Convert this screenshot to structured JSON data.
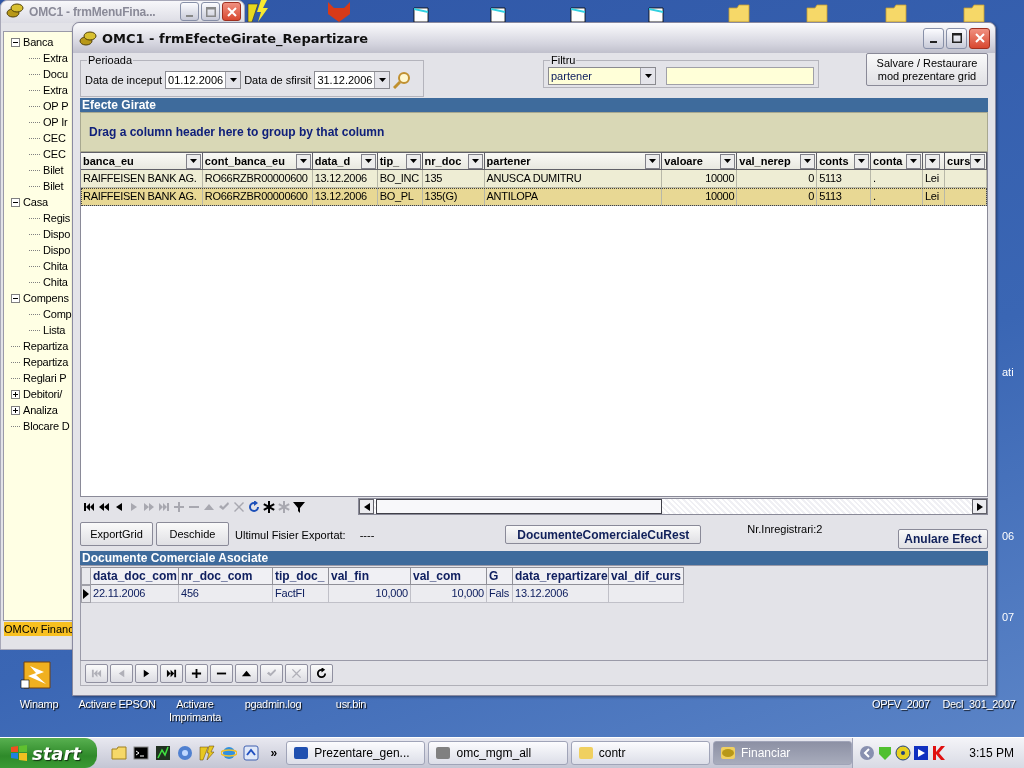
{
  "desktop": {
    "bottom_icons": [
      {
        "label": "Winamp"
      },
      {
        "label": "Activare EPSON"
      },
      {
        "label": "Activare Imprimanta"
      },
      {
        "label": "pgadmin.log"
      },
      {
        "label": "usr.bin"
      },
      {
        "label": "OPFV_2007"
      },
      {
        "label": "Decl_301_2007"
      }
    ],
    "edge_labels": [
      "ati",
      "06",
      "07"
    ]
  },
  "back_window": {
    "title": "OMC1 - frmMenuFina...",
    "tree": [
      {
        "label": "Banca",
        "expanded": true,
        "children": [
          {
            "label": "Extra"
          },
          {
            "label": "Docu"
          },
          {
            "label": "Extra"
          },
          {
            "label": "OP P"
          },
          {
            "label": "OP Ir"
          },
          {
            "label": "CEC"
          },
          {
            "label": "CEC"
          },
          {
            "label": "Bilet"
          },
          {
            "label": "Bilet"
          }
        ]
      },
      {
        "label": "Casa",
        "expanded": true,
        "children": [
          {
            "label": "Regis"
          },
          {
            "label": "Dispo"
          },
          {
            "label": "Dispo"
          },
          {
            "label": "Chita"
          },
          {
            "label": "Chita"
          }
        ]
      },
      {
        "label": "Compens",
        "expanded": true,
        "children": [
          {
            "label": "Comp"
          },
          {
            "label": "Lista"
          }
        ]
      },
      {
        "label": "Repartiza"
      },
      {
        "label": "Repartiza"
      },
      {
        "label": "Reglari P"
      },
      {
        "label": "Debitori/",
        "expanded": false
      },
      {
        "label": "Analiza",
        "expanded": false
      },
      {
        "label": "Blocare D"
      }
    ],
    "status": "OMCw Financ"
  },
  "window": {
    "title": "OMC1 - frmEfecteGirate_Repartizare",
    "period": {
      "legend": "Perioada",
      "start_label": "Data de inceput",
      "start_value": "01.12.2006",
      "end_label": "Data de sfirsit",
      "end_value": "31.12.2006"
    },
    "filter": {
      "legend": "Filtru",
      "field": "partener"
    },
    "save_button": "Salvare / Restaurare\nmod prezentare grid",
    "section_1": "Efecte Girate",
    "group_panel": "Drag a column header here to group by that column",
    "table": {
      "columns": [
        {
          "label": "banca_eu"
        },
        {
          "label": "cont_banca_eu"
        },
        {
          "label": "data_d"
        },
        {
          "label": "tip_"
        },
        {
          "label": "nr_doc"
        },
        {
          "label": "partener"
        },
        {
          "label": "valoare"
        },
        {
          "label": "val_nerep"
        },
        {
          "label": "conts"
        },
        {
          "label": "conta"
        },
        {},
        {
          "label": "curs"
        }
      ],
      "rows": [
        {
          "selected": false,
          "cells": [
            "RAIFFEISEN BANK AG.",
            "RO66RZBR00000600",
            "13.12.2006",
            "BO_INC",
            "135",
            "ANUSCA DUMITRU",
            "10000",
            "0",
            "5113",
            ".",
            "Lei",
            null
          ]
        },
        {
          "selected": true,
          "cells": [
            "RAIFFEISEN BANK AG.",
            "RO66RZBR00000600",
            "13.12.2006",
            "BO_PL",
            "135(G)",
            "ANTILOPA",
            "10000",
            "0",
            "5113",
            ".",
            "Lei",
            null
          ]
        }
      ]
    },
    "navigator": [
      {
        "kind": "first",
        "disabled": false
      },
      {
        "kind": "prev_page",
        "disabled": false
      },
      {
        "kind": "prev",
        "disabled": false
      },
      {
        "kind": "next",
        "disabled": true
      },
      {
        "kind": "next_page",
        "disabled": true
      },
      {
        "kind": "last",
        "disabled": true
      },
      {
        "kind": "add",
        "disabled": true
      },
      {
        "kind": "remove",
        "disabled": true
      },
      {
        "kind": "up",
        "disabled": true
      },
      {
        "kind": "check",
        "disabled": true
      },
      {
        "kind": "cancel",
        "disabled": true
      },
      {
        "kind": "refresh",
        "disabled": false
      },
      {
        "kind": "star",
        "disabled": false
      },
      {
        "kind": "star",
        "disabled": true
      },
      {
        "kind": "filter",
        "disabled": false
      }
    ],
    "export_button": "ExportGrid",
    "open_button": "Deschide",
    "last_export_label": "Ultimul Fisier Exportat:",
    "last_export_value": "----",
    "docs_button": "DocumenteComercialeCuRest",
    "record_count": "Nr.Inregistrari:2",
    "cancel_button": "Anulare Efect",
    "section_2": "Documente Comerciale Asociate",
    "table_2": {
      "columns": [
        "data_doc_com",
        "nr_doc_com",
        "tip_doc_",
        "val_fin",
        "val_com",
        "G",
        "data_repartizare",
        "val_dif_curs"
      ],
      "rows": [
        {
          "current": true,
          "cells": [
            "22.11.2006",
            "456",
            "FactFI",
            "10,000",
            "10,000",
            "Fals",
            "13.12.2006",
            null
          ]
        }
      ]
    },
    "bottom_navigator": [
      {
        "kind": "first",
        "disabled": true
      },
      {
        "kind": "prev",
        "disabled": true
      },
      {
        "kind": "next",
        "disabled": false
      },
      {
        "kind": "last",
        "disabled": false
      },
      {
        "kind": "add",
        "disabled": false
      },
      {
        "kind": "remove",
        "disabled": false
      },
      {
        "kind": "up",
        "disabled": false
      },
      {
        "kind": "check",
        "disabled": true
      },
      {
        "kind": "cancel",
        "disabled": true
      },
      {
        "kind": "refresh",
        "disabled": false
      }
    ]
  },
  "taskbar": {
    "start": "start",
    "overflow": "»",
    "tasks": [
      {
        "label": "Prezentare_gen...",
        "selected": false
      },
      {
        "label": "omc_mgm_all",
        "selected": false
      },
      {
        "label": "contr",
        "selected": false
      },
      {
        "label": "Financiar",
        "selected": true
      }
    ],
    "clock": "3:15 PM"
  }
}
